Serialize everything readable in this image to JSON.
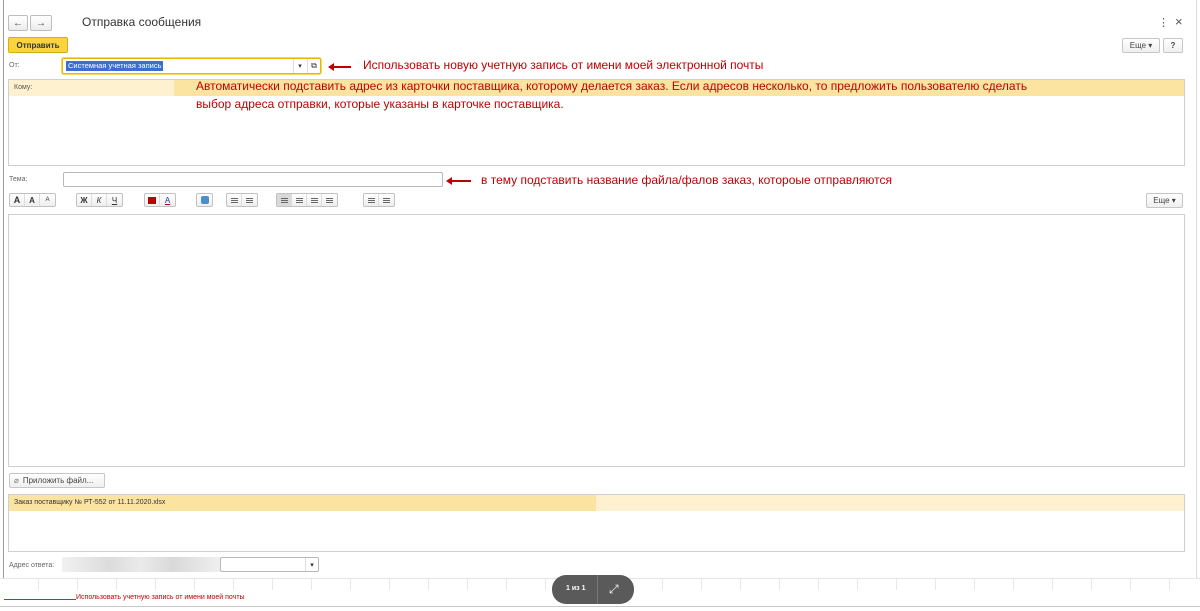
{
  "window": {
    "title": "Отправка сообщения",
    "back_icon": "←",
    "forward_icon": "→",
    "menu_icon": "⋮",
    "close_icon": "×"
  },
  "toolbar": {
    "send_label": "Отправить",
    "more_label": "Еще ▾",
    "help_label": "?"
  },
  "from": {
    "label": "От:",
    "value": "Системная учетная запись",
    "dropdown_icon": "▾",
    "open_icon": "⧉"
  },
  "to": {
    "label": "Кому:"
  },
  "subject": {
    "label": "Тема:",
    "value": ""
  },
  "format_toolbar": {
    "font_big": "A",
    "font_grow": "A",
    "font_shrink": "A",
    "bold": "Ж",
    "italic": "К",
    "underline": "Ч",
    "more_label": "Еще ▾"
  },
  "attachments": {
    "attach_label": "Приложить файл...",
    "files": [
      "Заказ поставщику № РТ-552 от 11.11.2020.xlsx"
    ]
  },
  "reply": {
    "label": "Адрес ответа:",
    "dropdown_icon": "▾"
  },
  "annotations": {
    "from_note": "Использовать новую учетную запись от имени моей электронной почты",
    "to_note_line1": "Автоматически подставить адрес из карточки поставщика, которому делается заказ. Если адресов несколько, то предложить пользователю сделать",
    "to_note_line2": "выбор адреса отправки, которые указаны в карточке поставщика.",
    "subject_note": "в тему подставить название файла/фалов заказ, котороые отправляются",
    "bottom_note": "Использовать учетную  запись от имени моей почты"
  },
  "viewer": {
    "page_counter": "1 из 1",
    "expand_icon": "⤢"
  },
  "colors": {
    "accent": "#f9d43f",
    "highlight_row": "#fbe3a1",
    "annotation": "#c00000",
    "selection": "#3a6fcf"
  }
}
